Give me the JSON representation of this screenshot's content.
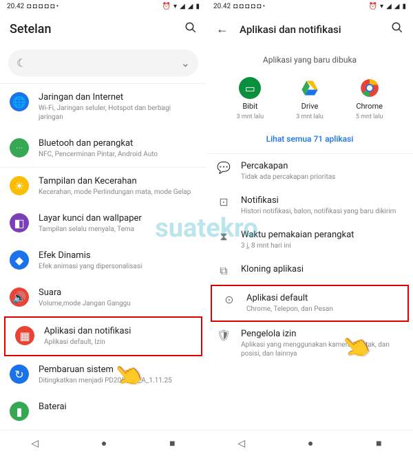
{
  "status": {
    "time": "20.42",
    "dots": "◘ ◘ ◘ ◘ ◘ •"
  },
  "left": {
    "title": "Setelan",
    "rows": [
      {
        "title": "Jaringan dan Internet",
        "sub": "Wi-Fi, Jaringan seluler, Hotspot dan berbagi jaringan"
      },
      {
        "title": "Bluetooh dan perangkat",
        "sub": "NFC, Pencerminan Pintar, Android Auto"
      },
      {
        "title": "Tampilan dan Kecerahan",
        "sub": "Kecerahan, mode Perlindungan mata, mode Gelap"
      },
      {
        "title": "Layar kunci dan wallpaper",
        "sub": "Tampilan selalu menyala, Tema"
      },
      {
        "title": "Efek Dinamis",
        "sub": "Efek animasi yang dipersonalisasi"
      },
      {
        "title": "Suara",
        "sub": "Volume,mode Jangan Ganggu"
      },
      {
        "title": "Aplikasi dan notifikasi",
        "sub": "Aplikasi default, Izin"
      },
      {
        "title": "Pembaruan sistem",
        "sub": "Ditingkatkan menjadi PD205 _EX_A_1.11.25"
      },
      {
        "title": "Baterai",
        "sub": ""
      }
    ]
  },
  "right": {
    "title": "Aplikasi dan notifikasi",
    "section_title": "Aplikasi yang baru dibuka",
    "apps": [
      {
        "name": "Bibit",
        "time": "3 mnt lalu"
      },
      {
        "name": "Drive",
        "time": "3 mnt lalu"
      },
      {
        "name": "Chrome",
        "time": "5 mnt lalu"
      }
    ],
    "see_all": "Lihat semua 71 aplikasi",
    "rows": [
      {
        "title": "Percakapan",
        "sub": "Tidak ada percakapan prioritas"
      },
      {
        "title": "Notifikasi",
        "sub": "Histori notifikasi, balon, notifikasi yang baru dikirim"
      },
      {
        "title": "Waktu pemakaian perangkat",
        "sub": "3 j, 8 mnt hari ini"
      },
      {
        "title": "Kloning aplikasi",
        "sub": ""
      },
      {
        "title": "Aplikasi default",
        "sub": "Chrome, Telepon, dan Pesan"
      },
      {
        "title": "Pengelola izin",
        "sub": "Aplikasi yang menggunakan kamera, kontak, dan posisi, dan lainnya"
      }
    ]
  },
  "watermark": "suatekro"
}
